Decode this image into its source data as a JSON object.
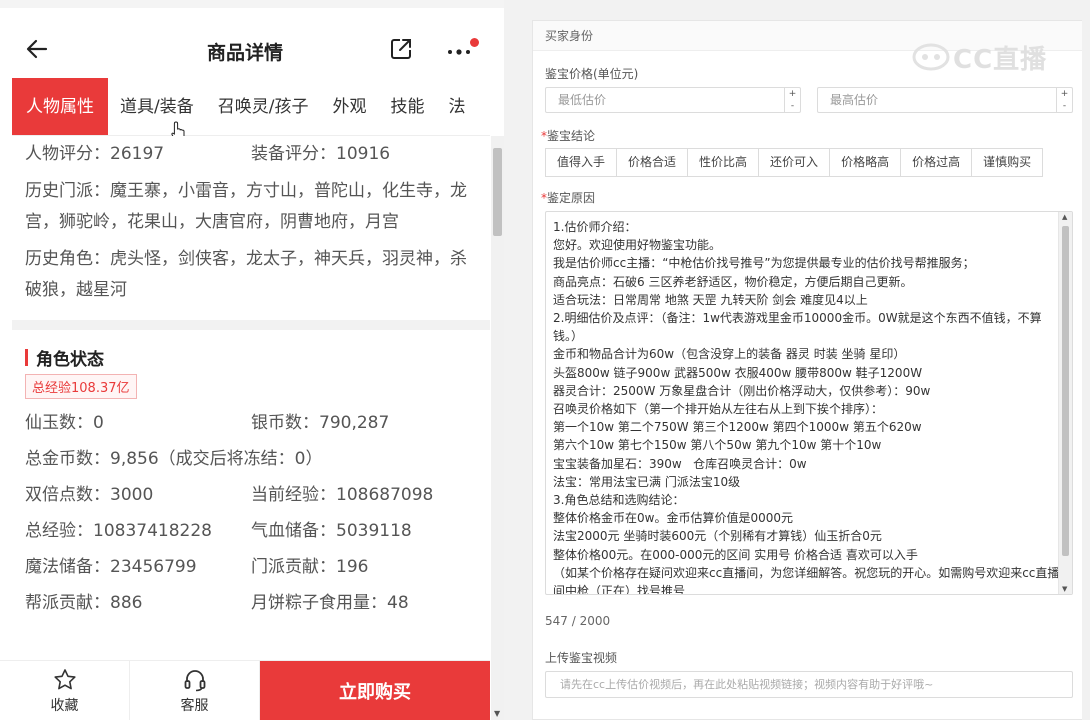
{
  "header": {
    "title": "商品详情"
  },
  "tabs": [
    "人物属性",
    "道具/装备",
    "召唤灵/孩子",
    "外观",
    "技能",
    "法"
  ],
  "attributes": {
    "person_score": "人物评分：26197",
    "equip_score": "装备评分：10916",
    "history_school": "历史门派：魔王寨，小雷音，方寸山，普陀山，化生寺，龙宫，狮驼岭，花果山，大唐官府，阴曹地府，月宫",
    "history_role": "历史角色：虎头怪，剑侠客，龙太子，神天兵，羽灵神，杀破狼，越星河"
  },
  "status": {
    "title": "角色状态",
    "badge": "总经验108.37亿",
    "rows": [
      [
        "仙玉数：0",
        "银币数：790,287"
      ],
      [
        "总金币数：9,856（成交后将冻结：0）",
        ""
      ],
      [
        "双倍点数：3000",
        "当前经验：108687098"
      ],
      [
        "总经验：10837418228",
        "气血储备：5039118"
      ],
      [
        "魔法储备：23456799",
        "门派贡献：196"
      ],
      [
        "帮派贡献：886",
        "月饼粽子食用量：48"
      ]
    ]
  },
  "bottom": {
    "fav": "收藏",
    "service": "客服",
    "buy": "立即购买"
  },
  "right": {
    "section_title": "买家身份",
    "watermark": "CC直播",
    "price_label": "鉴宝价格(单位元)",
    "min_placeholder": "最低估价",
    "max_placeholder": "最高估价",
    "conclusion_label": "鉴宝结论",
    "conclusions": [
      "值得入手",
      "价格合适",
      "性价比高",
      "还价可入",
      "价格略高",
      "价格过高",
      "谨慎购买"
    ],
    "reason_label": "鉴定原因",
    "reason_lines": [
      "1.估价师介绍：",
      "您好。欢迎使用好物鉴宝功能。",
      "我是估价师cc主播：“中枪估价找号推号”为您提供最专业的估价找号帮推服务；",
      "商品亮点：石破6 三区养老舒适区，物价稳定，方便后期自己更新。",
      "适合玩法：日常周常 地煞 天罡 九转天阶 剑会 难度见4以上",
      "2.明细估价及点评：（备注：1w代表游戏里金币10000金币。0W就是这个东西不值钱，不算钱。）",
      "金币和物品合计为60w（包含没穿上的装备 器灵 时装 坐骑 星印）",
      "头盔800w 链子900w 武器500w 衣服400w 腰带800w 鞋子1200W",
      "器灵合计：2500W 万象星盘合计（刚出价格浮动大，仅供参考）：90w",
      "召唤灵价格如下（第一个排开始从左往右从上到下挨个排序）：",
      "第一个10w 第二个750W 第三个1200w 第四个1000w 第五个620w",
      "第六个10w 第七个150w 第八个50w 第九个10w 第十个10w",
      "宝宝装备加星石：390w   仓库召唤灵合计：0w",
      "法宝：常用法宝已满 门派法宝10级",
      "3.角色总结和选购结论：",
      "整体价格金币在0w。金币估算价值是0000元",
      "法宝2000元 坐骑时装600元（个别稀有才算钱）仙玉折合0元",
      "整体价格00元。在000-000元的区间 实用号 价格合适 喜欢可以入手",
      "（如某个价格存在疑问欢迎来cc直播间，为您详细解答。祝您玩的开心。如需购号欢迎来cc直播间中枪（正在）找号推号"
    ],
    "count": "547 / 2000",
    "video_label": "上传鉴宝视频",
    "video_placeholder": "请先在cc上传估价视频后，再在此处粘贴视频链接；视频内容有助于好评哦~"
  }
}
